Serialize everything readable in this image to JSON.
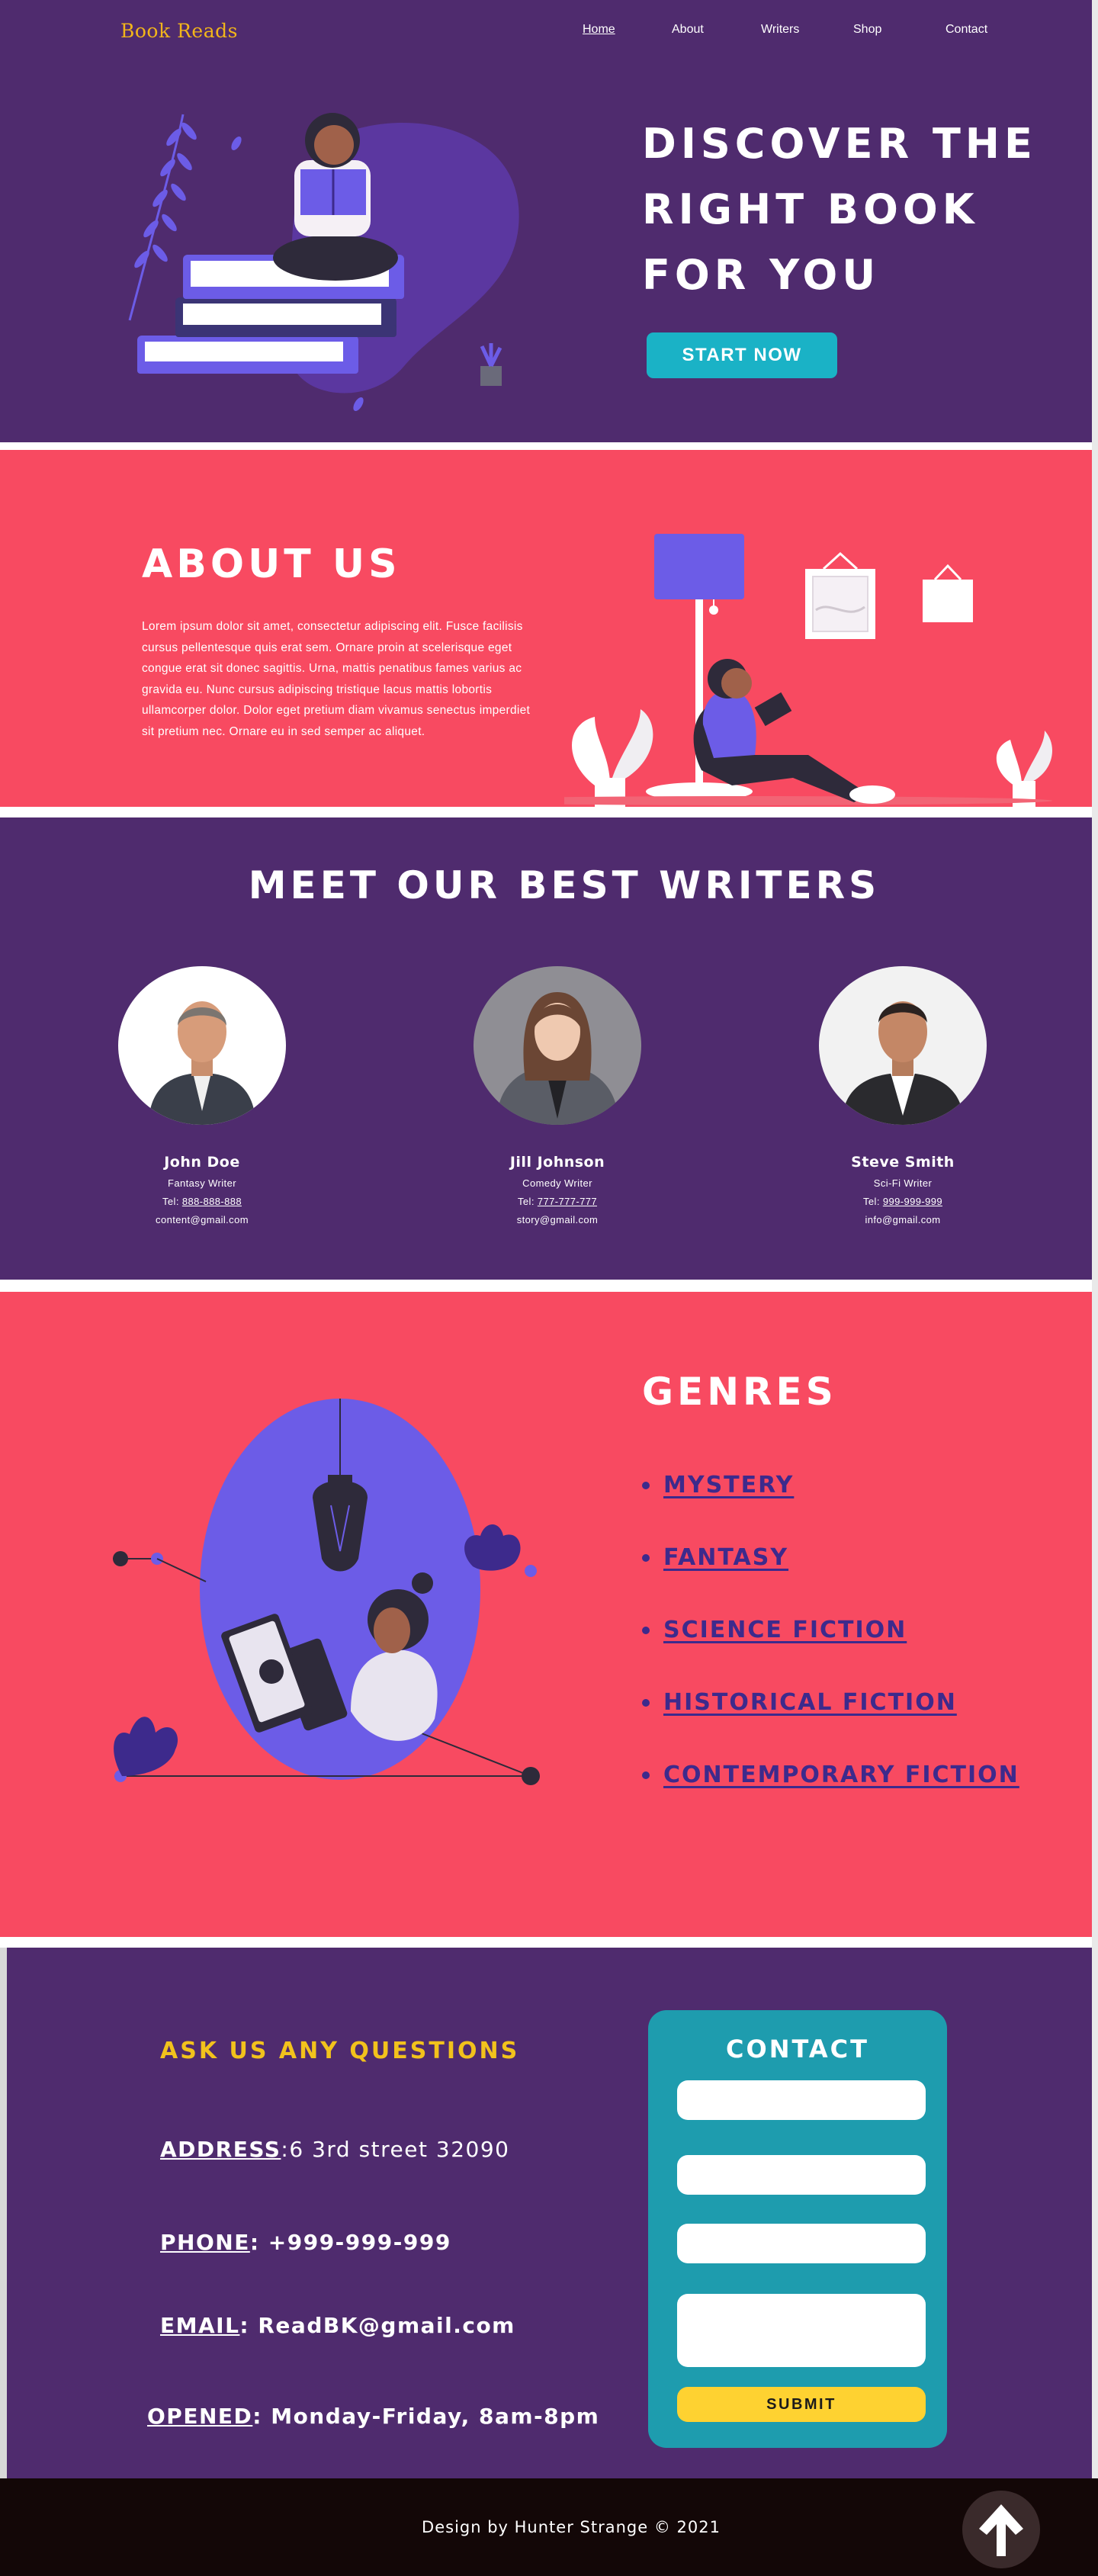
{
  "brand": "Book Reads",
  "nav": [
    {
      "label": "Home",
      "active": true
    },
    {
      "label": "About"
    },
    {
      "label": "Writers"
    },
    {
      "label": "Shop"
    },
    {
      "label": "Contact"
    }
  ],
  "hero": {
    "title_lines": [
      "DISCOVER THE",
      "RIGHT BOOK",
      "FOR YOU"
    ],
    "cta": "START NOW"
  },
  "about": {
    "title": "ABOUT US",
    "text": "Lorem ipsum dolor sit amet, consectetur adipiscing elit. Fusce facilisis cursus pellentesque quis erat sem. Ornare proin at scelerisque eget congue erat sit donec sagittis. Urna, mattis penatibus fames varius ac gravida eu. Nunc cursus adipiscing tristique lacus mattis lobortis ullamcorper dolor. Dolor eget pretium diam vivamus senectus imperdiet sit pretium nec. Ornare eu in sed semper ac aliquet."
  },
  "writers": {
    "title": "MEET OUR BEST WRITERS",
    "items": [
      {
        "name": "John Doe",
        "role": "Fantasy Writer",
        "tel_label": "Tel: ",
        "tel": "888-888-888",
        "email": "content@gmail.com"
      },
      {
        "name": "Jill Johnson",
        "role": "Comedy Writer",
        "tel_label": "Tel: ",
        "tel": "777-777-777",
        "email": "story@gmail.com"
      },
      {
        "name": "Steve Smith",
        "role": "Sci-Fi Writer",
        "tel_label": "Tel: ",
        "tel": "999-999-999",
        "email": "info@gmail.com"
      }
    ]
  },
  "genres": {
    "title": "GENRES",
    "items": [
      "MYSTERY",
      "FANTASY",
      "SCIENCE FICTION",
      "HISTORICAL FICTION",
      "CONTEMPORARY FICTION"
    ]
  },
  "contact": {
    "ask": "ASK US ANY QUESTIONS",
    "address_label": "ADDRESS",
    "address": ":6 3rd street 32090",
    "phone_label": "PHONE",
    "phone": ": +999-999-999",
    "email_label": "EMAIL",
    "email": ": ReadBK@gmail.com",
    "opened_label": "OPENED",
    "opened": ": Monday-Friday, 8am-8pm",
    "form_title": "CONTACT",
    "submit": "SUBMIT"
  },
  "footer": {
    "credit": "Design by Hunter Strange © 2021"
  },
  "colors": {
    "purple": "#4f2b6e",
    "coral": "#f84a61",
    "brand_gold": "#f2b51a",
    "teal": "#1ab2c6",
    "genre_blue": "#3d2a8c",
    "submit_yellow": "#fed231"
  }
}
